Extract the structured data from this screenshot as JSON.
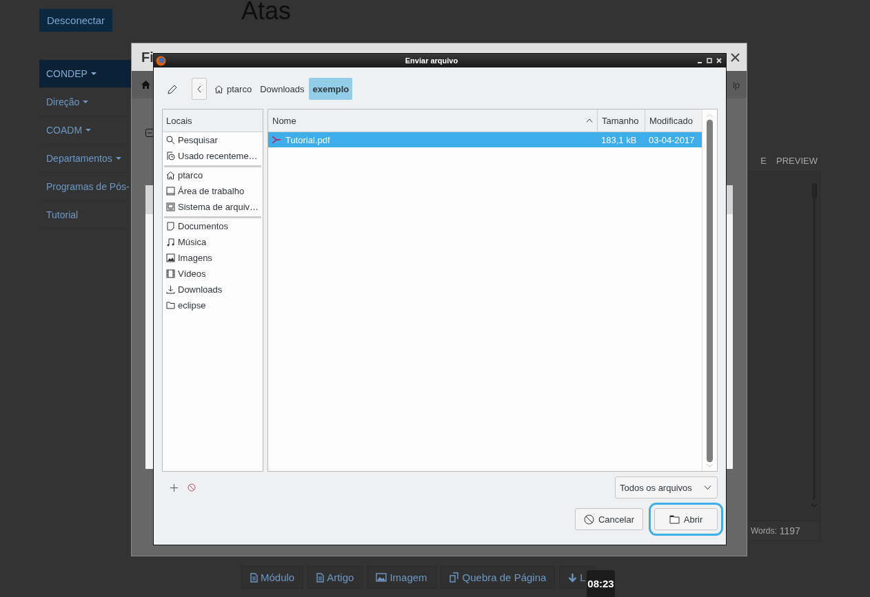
{
  "page": {
    "logout_button": "Desconectar",
    "heading": "Atas",
    "menu": [
      {
        "label": "CONDEP",
        "dropdown": true,
        "selected": true
      },
      {
        "label": "Direção",
        "dropdown": true,
        "selected": false
      },
      {
        "label": "COADM",
        "dropdown": true,
        "selected": false
      },
      {
        "label": "Departamentos",
        "dropdown": true,
        "selected": false
      },
      {
        "label": "Programas de Pós-",
        "dropdown": false,
        "selected": false
      },
      {
        "label": "Tutorial",
        "dropdown": false,
        "selected": false
      }
    ],
    "editor": {
      "tabs": [
        {
          "label": "E",
          "selected": false
        },
        {
          "label": "PREVIEW",
          "selected": false
        }
      ],
      "words_label": "Words:",
      "words": "1197"
    },
    "insert_buttons": [
      {
        "label": "Módulo",
        "kind": "document"
      },
      {
        "label": "Artigo",
        "kind": "document"
      },
      {
        "label": "Imagem",
        "kind": "image"
      },
      {
        "label": "Quebra de Página",
        "kind": "pages"
      },
      {
        "label": "L",
        "kind": "down"
      }
    ]
  },
  "modal": {
    "title": "Fi",
    "toolbar_text": "lp"
  },
  "dialog": {
    "title": "Enviar arquivo",
    "path": [
      {
        "label": "ptarco",
        "kind": "home",
        "selected": false
      },
      {
        "label": "Downloads",
        "kind": "plain",
        "selected": false
      },
      {
        "label": "exemplo",
        "kind": "plain",
        "selected": true
      }
    ],
    "places": {
      "header": "Locais",
      "groups": [
        {
          "items": [
            {
              "label": "Pesquisar",
              "kind": "search"
            },
            {
              "label": "Usado recenteme…",
              "kind": "recent"
            }
          ]
        },
        {
          "items": [
            {
              "label": "ptarco",
              "kind": "home"
            },
            {
              "label": "Área de trabalho",
              "kind": "desktop"
            },
            {
              "label": "Sistema de arquiv…",
              "kind": "filesystem"
            }
          ]
        },
        {
          "items": [
            {
              "label": "Documentos",
              "kind": "document"
            },
            {
              "label": "Música",
              "kind": "music"
            },
            {
              "label": "Imagens",
              "kind": "pictures"
            },
            {
              "label": "Vídeos",
              "kind": "videos"
            },
            {
              "label": "Downloads",
              "kind": "download"
            },
            {
              "label": "eclipse",
              "kind": "folder"
            }
          ]
        }
      ]
    },
    "columns": [
      {
        "label": "Nome",
        "sorted": true
      },
      {
        "label": "Tamanho",
        "sorted": false
      },
      {
        "label": "Modificado",
        "sorted": false
      }
    ],
    "files": [
      {
        "name": "Tutorial.pdf",
        "size": "183,1 kB",
        "modified": "03-04-2017",
        "selected": true
      }
    ],
    "filter": "Todos os arquivos",
    "buttons": [
      {
        "label": "Cancelar",
        "kind": "cancel",
        "focused": false
      },
      {
        "label": "Abrir",
        "kind": "open",
        "focused": true
      }
    ]
  },
  "clock": "08:23"
}
